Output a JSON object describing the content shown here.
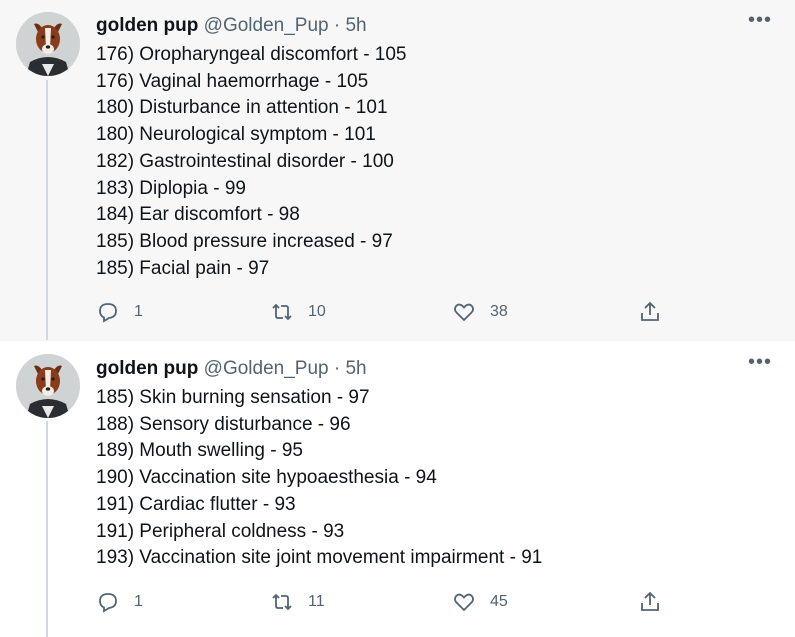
{
  "tweets": [
    {
      "author": {
        "name": "golden pup",
        "handle": "@Golden_Pup",
        "separator": "·",
        "time": "5h"
      },
      "lines": [
        "176) Oropharyngeal discomfort - 105",
        "176) Vaginal haemorrhage - 105",
        "180) Disturbance in attention - 101",
        "180) Neurological symptom - 101",
        "182) Gastrointestinal disorder - 100",
        "183) Diplopia - 99",
        "184) Ear discomfort - 98",
        "185) Blood pressure increased - 97",
        "185) Facial pain - 97"
      ],
      "actions": {
        "replies": "1",
        "retweets": "10",
        "likes": "38"
      }
    },
    {
      "author": {
        "name": "golden pup",
        "handle": "@Golden_Pup",
        "separator": "·",
        "time": "5h"
      },
      "lines": [
        "185) Skin burning sensation - 97",
        "188) Sensory disturbance - 96",
        "189) Mouth swelling - 95",
        "190) Vaccination site hypoaesthesia - 94",
        "191) Cardiac flutter - 93",
        "191) Peripheral coldness - 93",
        "193) Vaccination site joint movement impairment - 91"
      ],
      "actions": {
        "replies": "1",
        "retweets": "11",
        "likes": "45"
      }
    }
  ],
  "icons": {
    "more": "more-horizontal-icon",
    "reply": "reply-icon",
    "retweet": "retweet-icon",
    "like": "heart-icon",
    "share": "share-icon",
    "avatar": "dog-avatar"
  },
  "colors": {
    "text": "#0f1419",
    "secondary": "#536471",
    "thread_line": "#cfd9de",
    "highlight_bg": "#f7f7f7"
  }
}
